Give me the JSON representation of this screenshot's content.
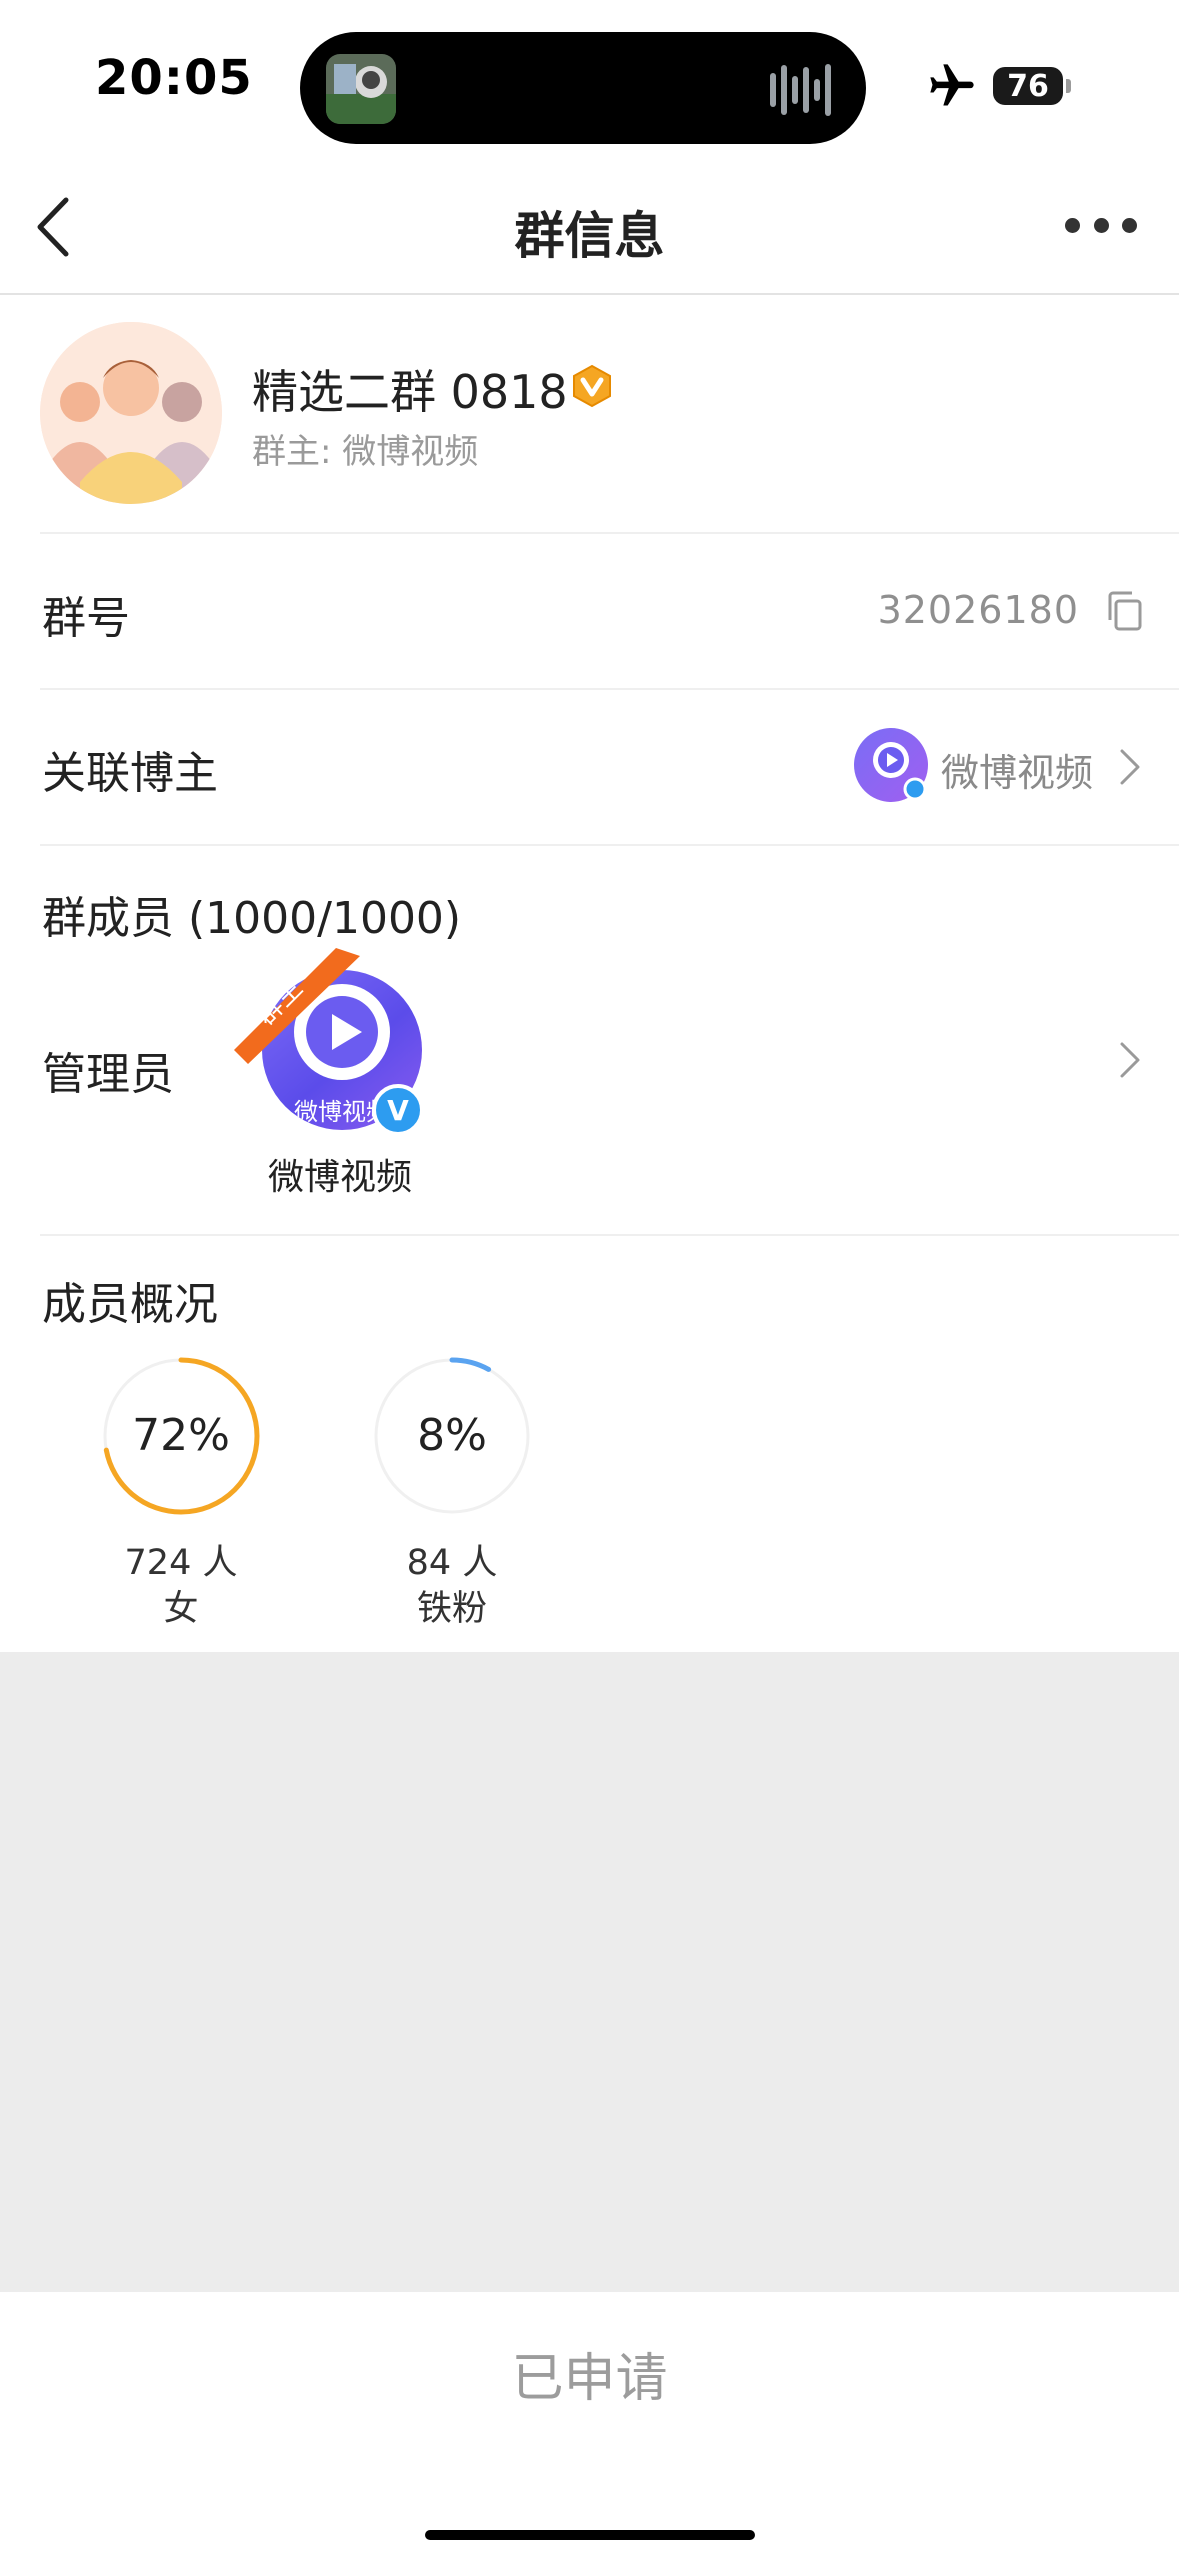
{
  "status_bar": {
    "time": "20:05",
    "battery": "76",
    "airplane_icon": "airplane-icon"
  },
  "nav": {
    "title": "群信息",
    "back_icon": "chevron-left-icon",
    "more_icon": "more-dots-icon"
  },
  "group": {
    "name": "精选二群 0818",
    "owner": "群主: 微博视频",
    "badge_icon": "vip-badge-icon"
  },
  "group_id": {
    "label": "群号",
    "value": "32026180",
    "copy_icon": "copy-icon"
  },
  "linked_blogger": {
    "label": "关联博主",
    "name": "微博视频"
  },
  "members": {
    "label": "群成员 (1000/1000)"
  },
  "admins": {
    "label": "管理员",
    "ribbon": "群主",
    "name": "微博视频",
    "avatar_text": "微博视频"
  },
  "overview": {
    "label": "成员概况",
    "stats": [
      {
        "percent_text": "72%",
        "percent": 72,
        "count": "724 人",
        "category": "女",
        "color": "#f5a623"
      },
      {
        "percent_text": "8%",
        "percent": 8,
        "count": "84 人",
        "category": "铁粉",
        "color": "#5aa3f0"
      }
    ]
  },
  "bottom": {
    "button_label": "已申请"
  }
}
